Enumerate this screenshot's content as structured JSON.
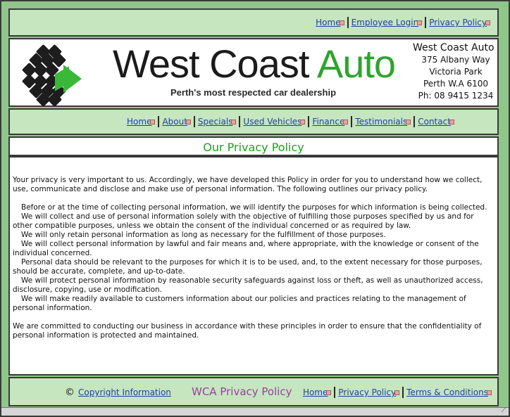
{
  "top_nav": {
    "items": [
      {
        "label": "Home",
        "icon": "external-link-icon"
      },
      {
        "label": "Employee Login",
        "icon": "external-link-icon"
      },
      {
        "label": "Privacy Policy",
        "icon": "external-link-icon"
      }
    ]
  },
  "header": {
    "brand_main": "West Coast ",
    "brand_accent": "Auto",
    "tagline": "Perth's most respected car dealership",
    "address": {
      "name": "West Coast Auto",
      "street": "375 Albany Way",
      "suburb": "Victoria Park",
      "city": "Perth  W.A 6100",
      "phone": "Ph: 08 9415 1234"
    }
  },
  "main_nav": {
    "items": [
      {
        "label": "Home"
      },
      {
        "label": "About"
      },
      {
        "label": "Specials"
      },
      {
        "label": "Used Vehicles"
      },
      {
        "label": "Finance"
      },
      {
        "label": "Testimonials"
      },
      {
        "label": "Contact"
      }
    ]
  },
  "page": {
    "title": "Our Privacy Policy",
    "intro": "Your privacy is very important to us. Accordingly, we have developed this Policy in order for you to understand how we collect, use, communicate and disclose and make use of personal information. The following outlines our privacy policy.",
    "points": [
      "Before or at the time of collecting personal information, we will identify the purposes for which information is being collected.",
      "We will collect and use of personal information solely with the objective of fulfilling those purposes specified by us and for other compatible purposes, unless we obtain the consent of the individual concerned or as required by law.",
      "We will only retain personal information as long as necessary for the fulfillment of those purposes.",
      "We will collect personal information by lawful and fair means and, where appropriate, with the knowledge or consent of the individual concerned.",
      "Personal data should be relevant to the purposes for which it is to be used, and, to the extent necessary for those purposes, should be accurate, complete, and up-to-date.",
      "We will protect personal information by reasonable security safeguards against loss or theft, as well as unauthorized access, disclosure, copying, use or modification.",
      "We will make readily available to customers information about our policies and practices relating to the management of personal information."
    ],
    "closing": "We are committed to conducting our business in accordance with these principles in order to ensure that the confidentiality of personal information is protected and maintained."
  },
  "footer": {
    "copyright_symbol": "©",
    "copyright_link": "Copyright Information",
    "title": "WCA Privacy Policy",
    "links": [
      {
        "label": "Home"
      },
      {
        "label": "Privacy Policy"
      },
      {
        "label": "Terms & Conditions"
      }
    ]
  },
  "colors": {
    "frame": "#8fc78a",
    "band": "#c5e6bf",
    "link": "#1f3fa8",
    "title_green": "#1aa31a",
    "footer_purple": "#9a3fa1"
  }
}
